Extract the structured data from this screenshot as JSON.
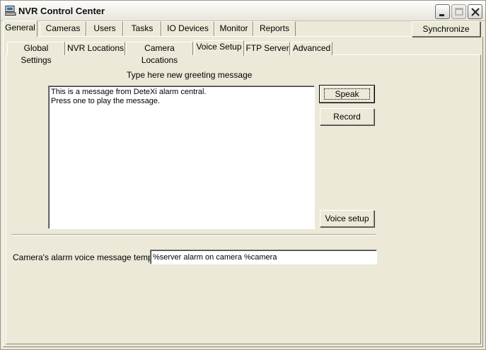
{
  "window": {
    "title": "NVR Control Center",
    "app_icon": "computer-icon",
    "controls": [
      "minimize-icon",
      "maximize-icon",
      "close-icon"
    ]
  },
  "main_tabs": [
    "General",
    "Cameras",
    "Users",
    "Tasks",
    "IO Devices",
    "Monitor",
    "Reports"
  ],
  "main_tab_active": "General",
  "sync_label": "Synchronize",
  "sub_tabs": [
    "Global Settings",
    "NVR Locations",
    "Camera Locations",
    "Voice Setup",
    "FTP Server",
    "Advanced"
  ],
  "sub_tab_active": "Voice Setup",
  "voice": {
    "greeting_label": "Type here new greeting message",
    "greeting_text": "This is a message from DeteXi alarm central.\nPress one to play the message.",
    "speak_label": "Speak",
    "record_label": "Record",
    "voice_setup_label": "Voice setup",
    "template_label": "Camera's alarm voice message template:",
    "template_value": "%server alarm on camera %camera"
  }
}
